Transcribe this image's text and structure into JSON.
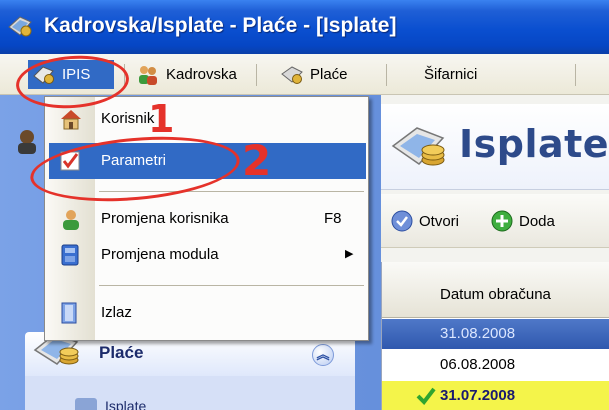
{
  "window": {
    "title": "Kadrovska/Isplate - Plaće - [Isplate]"
  },
  "menubar": {
    "items": [
      {
        "label": "IPIS",
        "icon": "ipis-icon"
      },
      {
        "label": "Kadrovska",
        "icon": "people-icon"
      },
      {
        "label": "Plaće",
        "icon": "money-icon"
      },
      {
        "label": "Šifarnici",
        "icon": ""
      }
    ]
  },
  "dropdown": {
    "items": [
      {
        "label": "Korisnik",
        "icon": "home-icon",
        "shortcut": "",
        "submenu": false
      },
      {
        "label": "Parametri",
        "icon": "checkmark-icon",
        "shortcut": "",
        "submenu": false,
        "selected": true
      },
      {
        "label": "Promjena korisnika",
        "icon": "user-icon",
        "shortcut": "F8",
        "submenu": false
      },
      {
        "label": "Promjena modula",
        "icon": "module-icon",
        "shortcut": "",
        "submenu": true
      },
      {
        "label": "Izlaz",
        "icon": "exit-icon",
        "shortcut": "",
        "submenu": false
      }
    ]
  },
  "left_panel": {
    "header_label": "Plaće",
    "body_item": "Isplate"
  },
  "content": {
    "title": "Isplate",
    "toolbar": {
      "open_label": "Otvori",
      "add_label": "Doda"
    },
    "grid": {
      "column_header": "Datum obračuna",
      "rows": [
        "31.08.2008",
        "06.08.2008",
        "31.07.2008"
      ]
    }
  },
  "annotations": {
    "step1": "1",
    "step2": "2"
  },
  "colors": {
    "titlebar": "#0a4fd0",
    "selection": "#316ac5",
    "annotation": "#e5322a",
    "highlight_row": "#f4f44a"
  }
}
